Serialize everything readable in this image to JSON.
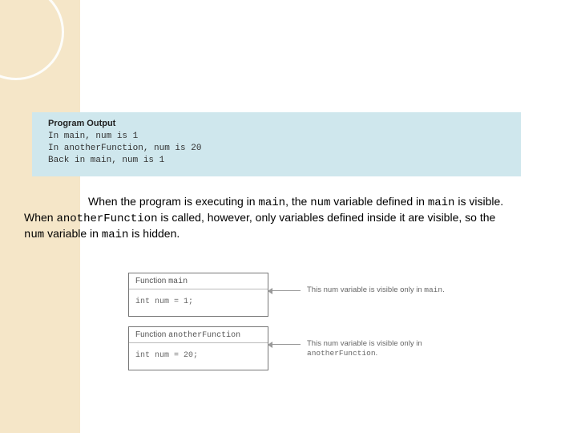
{
  "sidebar": {},
  "output": {
    "title": "Program Output",
    "lines": "In main, num is 1\nIn anotherFunction, num is 20\nBack in main, num is 1"
  },
  "paragraph": {
    "t1": "When the program is executing in ",
    "c1": "main",
    "t2": ", the ",
    "c2": "num",
    "t3": " variable defined in ",
    "c3": "main",
    "t4": " is visible. When ",
    "c4": "anotherFunction",
    "t5": " is called, however, only variables defined inside it are visible, so the ",
    "c5": "num",
    "t6": " variable in ",
    "c6": "main",
    "t7": " is hidden."
  },
  "diagram": {
    "box1": {
      "head_prefix": "Function ",
      "head_name": "main",
      "body": "int num = 1;",
      "caption_prefix": "This num variable is visible only in ",
      "caption_code": "main",
      "caption_suffix": "."
    },
    "box2": {
      "head_prefix": "Function ",
      "head_name": "anotherFunction",
      "body": "int num = 20;",
      "caption_prefix": "This num variable is visible only in ",
      "caption_code": "anotherFunction",
      "caption_suffix": "."
    }
  }
}
